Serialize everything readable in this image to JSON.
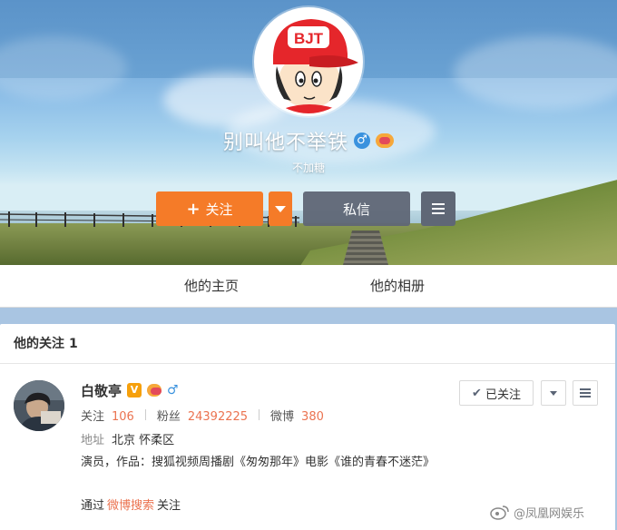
{
  "profile": {
    "name": "别叫他不举铁",
    "description": "不加糖",
    "avatar_badge_text": "BJT",
    "gender_icon": "male-icon",
    "vip_icon": "vip-icon"
  },
  "actions": {
    "follow_plus": "+",
    "follow_label": "关注",
    "message_label": "私信"
  },
  "tabs": [
    {
      "label": "他的主页"
    },
    {
      "label": "他的相册"
    }
  ],
  "following_card": {
    "title": "他的关注",
    "count": "1",
    "user": {
      "name": "白敬亭",
      "verified_badge": "V",
      "stats": [
        {
          "label": "关注",
          "value": "106"
        },
        {
          "label": "粉丝",
          "value": "24392225"
        },
        {
          "label": "微博",
          "value": "380"
        }
      ],
      "address_label": "地址",
      "address": "北京 怀柔区",
      "bio": "演员，作品：搜狐视频周播剧《匆匆那年》电影《谁的青春不迷茫》",
      "via_prefix": "通过",
      "via_link": "微博搜索",
      "via_suffix": "关注"
    },
    "followed_label": "已关注",
    "followed_check": "✔"
  },
  "watermark": "@凤凰网娱乐",
  "colors": {
    "accent_orange": "#f57b28",
    "dark_button": "#5f6776",
    "link_orange": "#eb7350",
    "male_blue": "#3a92de"
  }
}
